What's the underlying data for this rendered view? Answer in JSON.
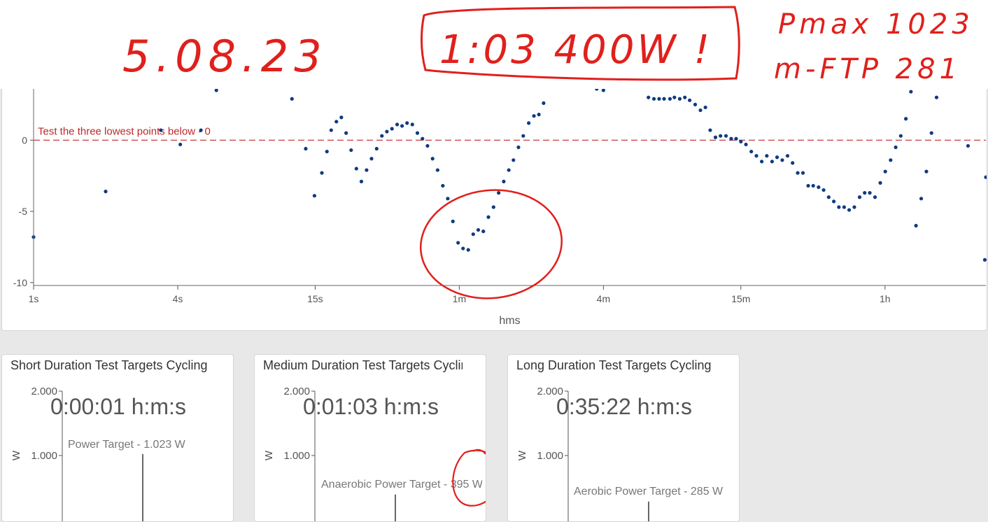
{
  "annotations": {
    "date": "5.08.23",
    "boxed_note": "1:03   400W !",
    "pmax": "Pmax 1023",
    "mftp": "m-FTP 281"
  },
  "chart_data": {
    "type": "scatter",
    "title": "",
    "xlabel": "hms",
    "ylabel": "",
    "x_scale": "log",
    "x_ticks": [
      {
        "label": "1s",
        "seconds": 1
      },
      {
        "label": "4s",
        "seconds": 4
      },
      {
        "label": "15s",
        "seconds": 15
      },
      {
        "label": "1m",
        "seconds": 60
      },
      {
        "label": "4m",
        "seconds": 240
      },
      {
        "label": "15m",
        "seconds": 900
      },
      {
        "label": "1h",
        "seconds": 3600
      }
    ],
    "y_ticks": [
      0,
      -5,
      -10
    ],
    "ylim": [
      -10.2,
      3.6
    ],
    "xlim_seconds": [
      1,
      9500
    ],
    "reference_line": {
      "y": 0,
      "label": "Test the three lowest points below - 0",
      "color": "#c0262a"
    },
    "point_color": "#0f3a80",
    "points": [
      [
        1.0,
        -6.8
      ],
      [
        2.0,
        -3.6
      ],
      [
        3.4,
        0.7
      ],
      [
        4.1,
        -0.3
      ],
      [
        5.0,
        0.7
      ],
      [
        5.8,
        3.5
      ],
      [
        12.0,
        2.9
      ],
      [
        13.7,
        -0.6
      ],
      [
        14.9,
        -3.9
      ],
      [
        16.0,
        -2.3
      ],
      [
        16.8,
        -0.8
      ],
      [
        17.5,
        0.7
      ],
      [
        18.4,
        1.3
      ],
      [
        19.3,
        1.6
      ],
      [
        20.2,
        0.5
      ],
      [
        21.2,
        -0.7
      ],
      [
        22.3,
        -2.0
      ],
      [
        23.4,
        -2.9
      ],
      [
        24.6,
        -2.1
      ],
      [
        25.8,
        -1.3
      ],
      [
        27.1,
        -0.6
      ],
      [
        28.5,
        0.3
      ],
      [
        29.9,
        0.6
      ],
      [
        31.4,
        0.8
      ],
      [
        33.0,
        1.1
      ],
      [
        34.6,
        1.0
      ],
      [
        36.3,
        1.2
      ],
      [
        38.2,
        1.1
      ],
      [
        40.1,
        0.5
      ],
      [
        42.1,
        0.1
      ],
      [
        44.2,
        -0.4
      ],
      [
        46.4,
        -1.3
      ],
      [
        48.7,
        -2.1
      ],
      [
        51.2,
        -3.2
      ],
      [
        53.7,
        -4.1
      ],
      [
        56.4,
        -5.7
      ],
      [
        59.3,
        -7.2
      ],
      [
        62.2,
        -7.6
      ],
      [
        65.4,
        -7.7
      ],
      [
        68.6,
        -6.6
      ],
      [
        72.0,
        -6.3
      ],
      [
        75.6,
        -6.4
      ],
      [
        79.4,
        -5.4
      ],
      [
        83.4,
        -4.7
      ],
      [
        87.6,
        -3.7
      ],
      [
        92.0,
        -2.9
      ],
      [
        96.6,
        -2.1
      ],
      [
        101.0,
        -1.4
      ],
      [
        106.0,
        -0.5
      ],
      [
        111.0,
        0.3
      ],
      [
        117.0,
        1.2
      ],
      [
        123.0,
        1.7
      ],
      [
        129.0,
        1.8
      ],
      [
        135.0,
        2.6
      ],
      [
        225.0,
        3.6
      ],
      [
        240.0,
        3.5
      ],
      [
        370.0,
        3.0
      ],
      [
        390.0,
        2.9
      ],
      [
        410.0,
        2.9
      ],
      [
        430.0,
        2.9
      ],
      [
        455.0,
        2.9
      ],
      [
        475.0,
        3.0
      ],
      [
        500.0,
        2.9
      ],
      [
        525.0,
        3.0
      ],
      [
        550.0,
        2.8
      ],
      [
        580.0,
        2.5
      ],
      [
        610.0,
        2.1
      ],
      [
        640.0,
        2.3
      ],
      [
        670.0,
        0.7
      ],
      [
        705.0,
        0.2
      ],
      [
        740.0,
        0.3
      ],
      [
        780.0,
        0.3
      ],
      [
        820.0,
        0.1
      ],
      [
        860.0,
        0.1
      ],
      [
        900.0,
        -0.1
      ],
      [
        945.0,
        -0.3
      ],
      [
        995.0,
        -0.8
      ],
      [
        1045.0,
        -1.1
      ],
      [
        1100.0,
        -1.5
      ],
      [
        1155.0,
        -1.1
      ],
      [
        1215.0,
        -1.5
      ],
      [
        1275.0,
        -1.2
      ],
      [
        1340.0,
        -1.4
      ],
      [
        1410.0,
        -1.1
      ],
      [
        1480.0,
        -1.6
      ],
      [
        1555.0,
        -2.3
      ],
      [
        1635.0,
        -2.3
      ],
      [
        1720.0,
        -3.2
      ],
      [
        1805.0,
        -3.2
      ],
      [
        1900.0,
        -3.3
      ],
      [
        1995.0,
        -3.5
      ],
      [
        2095.0,
        -4.0
      ],
      [
        2200.0,
        -4.3
      ],
      [
        2310.0,
        -4.7
      ],
      [
        2430.0,
        -4.7
      ],
      [
        2550.0,
        -4.9
      ],
      [
        2680.0,
        -4.7
      ],
      [
        2820.0,
        -4.0
      ],
      [
        2960.0,
        -3.7
      ],
      [
        3110.0,
        -3.7
      ],
      [
        3270.0,
        -4.0
      ],
      [
        3440.0,
        -3.0
      ],
      [
        3610.0,
        -2.2
      ],
      [
        3800.0,
        -1.4
      ],
      [
        3990.0,
        -0.5
      ],
      [
        4190.0,
        0.3
      ],
      [
        4400.0,
        1.5
      ],
      [
        4620.0,
        3.4
      ],
      [
        4850.0,
        -6.0
      ],
      [
        5100.0,
        -4.1
      ],
      [
        5360.0,
        -2.2
      ],
      [
        5630.0,
        0.5
      ],
      [
        5910.0,
        3.0
      ],
      [
        8000.0,
        -0.4
      ],
      [
        9400.0,
        -8.4
      ],
      [
        9500.0,
        -2.6
      ]
    ]
  },
  "panels": [
    {
      "title": "Short Duration Test Targets Cycling",
      "duration": "0:00:01 h:m:s",
      "target_label": "Power Target - 1.023 W",
      "target_watts": 1023,
      "y_ticks": [
        "2.000",
        "1.000"
      ],
      "y_axis": "W"
    },
    {
      "title": "Medium Duration Test Targets Cycling",
      "duration": "0:01:03 h:m:s",
      "target_label": "Anaerobic Power Target - 395 W",
      "target_watts": 395,
      "y_ticks": [
        "2.000",
        "1.000"
      ],
      "y_axis": "W"
    },
    {
      "title": "Long Duration Test Targets Cycling",
      "duration": "0:35:22 h:m:s",
      "target_label": "Aerobic Power Target - 285 W",
      "target_watts": 285,
      "y_ticks": [
        "2.000",
        "1.000"
      ],
      "y_axis": "W"
    }
  ],
  "colors": {
    "annotation": "#e0201c",
    "point": "#0f3a80",
    "reference": "#c0262a",
    "target_bar": "#666666"
  }
}
